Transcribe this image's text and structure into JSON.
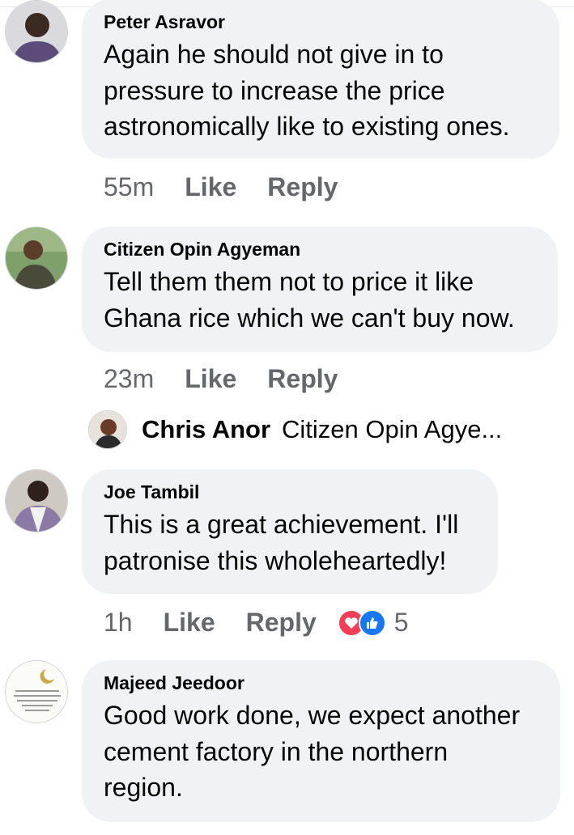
{
  "comments": [
    {
      "author": "Peter Asravor",
      "lines": [
        "Again he should not give in to",
        "pressure to increase the price",
        "astronomically like to existing ones."
      ],
      "time": "55m",
      "like": "Like",
      "reply": "Reply"
    },
    {
      "author": "Citizen Opin Agyeman",
      "lines": [
        "Tell them them not to price it like",
        "Ghana rice which we can't buy now."
      ],
      "time": "23m",
      "like": "Like",
      "reply": "Reply"
    },
    {
      "author": "Joe Tambil",
      "lines": [
        "This is a great achievement. I'll",
        "patronise this wholeheartedly!"
      ],
      "time": "1h",
      "like": "Like",
      "reply": "Reply",
      "reactions": {
        "icons": [
          "love-icon",
          "like-icon"
        ],
        "count": "5"
      }
    },
    {
      "author": "Majeed Jeedoor",
      "lines": [
        "Good work done, we expect another",
        "cement factory in the northern",
        "region."
      ]
    }
  ],
  "reply_preview": {
    "name": "Chris Anor",
    "text": "Citizen Opin Agye..."
  },
  "colors": {
    "bubble": "#f0f2f5",
    "meta": "#65676b",
    "love": "#f33e58",
    "like": "#1877f2"
  }
}
